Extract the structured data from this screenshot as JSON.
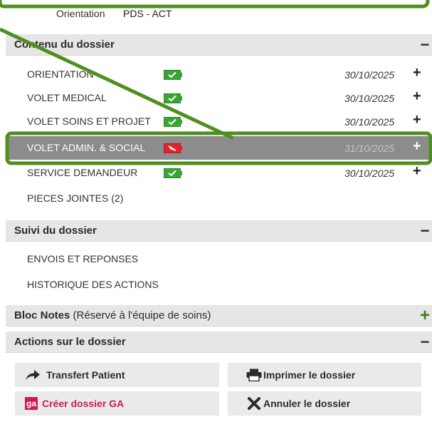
{
  "orientation": {
    "label": "Orientation",
    "value": "PDS - ACT"
  },
  "sections": {
    "contenu": {
      "title": "Contenu du dossier",
      "toggle": "−"
    },
    "suivi": {
      "title": "Suivi du dossier",
      "toggle": "−"
    },
    "bloc_notes": {
      "title": "Bloc Notes",
      "subtitle": "(Réservé à l'équipe de soins)",
      "toggle": "+"
    },
    "actions": {
      "title": "Actions sur le dossier",
      "toggle": "−"
    }
  },
  "documents": [
    {
      "label": "ORIENTATION",
      "date": "30/10/2025",
      "plus": "+",
      "status": "complete"
    },
    {
      "label": "VOLET MEDICAL",
      "date": "30/10/2025",
      "plus": "+",
      "status": "complete"
    },
    {
      "label": "VOLET SOINS ET PROJET",
      "date": "30/10/2025",
      "plus": "+",
      "status": "complete"
    },
    {
      "label": "VOLET ADMIN. & SOCIAL",
      "date": "31/10/2025",
      "plus": "+",
      "status": "incomplete"
    },
    {
      "label": "SERVICE DEMANDEUR",
      "date": "30/10/2025",
      "plus": "+",
      "status": "complete"
    }
  ],
  "attachments": {
    "label": "PIECES JOINTES (2)"
  },
  "suivi_items": [
    "ENVOIS ET REPONSES",
    "HISTORIQUE DES ACTIONS"
  ],
  "actions": {
    "transfer": {
      "label": "Transfert Patient",
      "icon": "arrow-forward-icon"
    },
    "print": {
      "label": "Imprimer le dossier",
      "icon": "printer-icon"
    },
    "create_ga": {
      "label": "Créer dossier GA",
      "badge": "ga"
    },
    "cancel": {
      "label": "Annuler le dossier",
      "icon": "cross-icon"
    }
  },
  "colors": {
    "highlight_outline": "#4f8f1e",
    "battery_ok": "#3aa535",
    "battery_bad": "#e0242d",
    "row_selected": "#8c8c8c",
    "section_header": "#e6e6e6",
    "ga_badge": "#d01a57"
  }
}
